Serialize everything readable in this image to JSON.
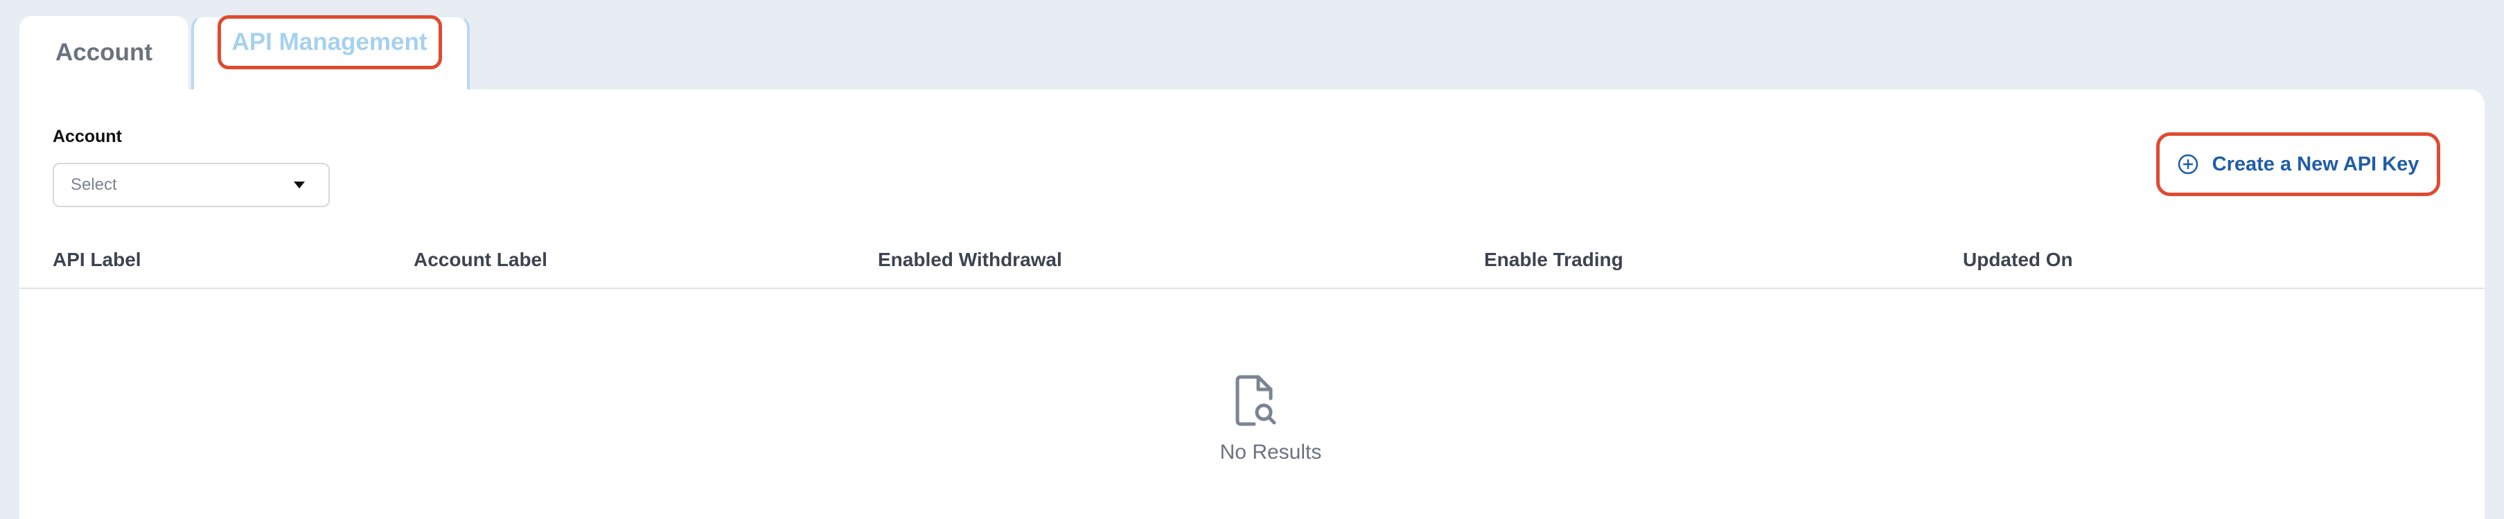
{
  "tabs": [
    {
      "label": "Account",
      "active": false
    },
    {
      "label": "API Management",
      "active": true
    }
  ],
  "filter": {
    "account_label": "Account",
    "account_select_value": "Select"
  },
  "actions": {
    "create_label": "Create a New API Key",
    "create_icon": "plus-circle-icon"
  },
  "table": {
    "columns": [
      "API Label",
      "Account Label",
      "Enabled Withdrawal",
      "Enable Trading",
      "Updated On"
    ],
    "rows": []
  },
  "empty_state": {
    "icon": "document-search-icon",
    "message": "No Results"
  },
  "colors": {
    "page_bg": "#e8ecf3",
    "accent_blue": "#1f5da8",
    "active_tab_text": "#a6d1ef",
    "highlight_red": "#e04a30"
  }
}
